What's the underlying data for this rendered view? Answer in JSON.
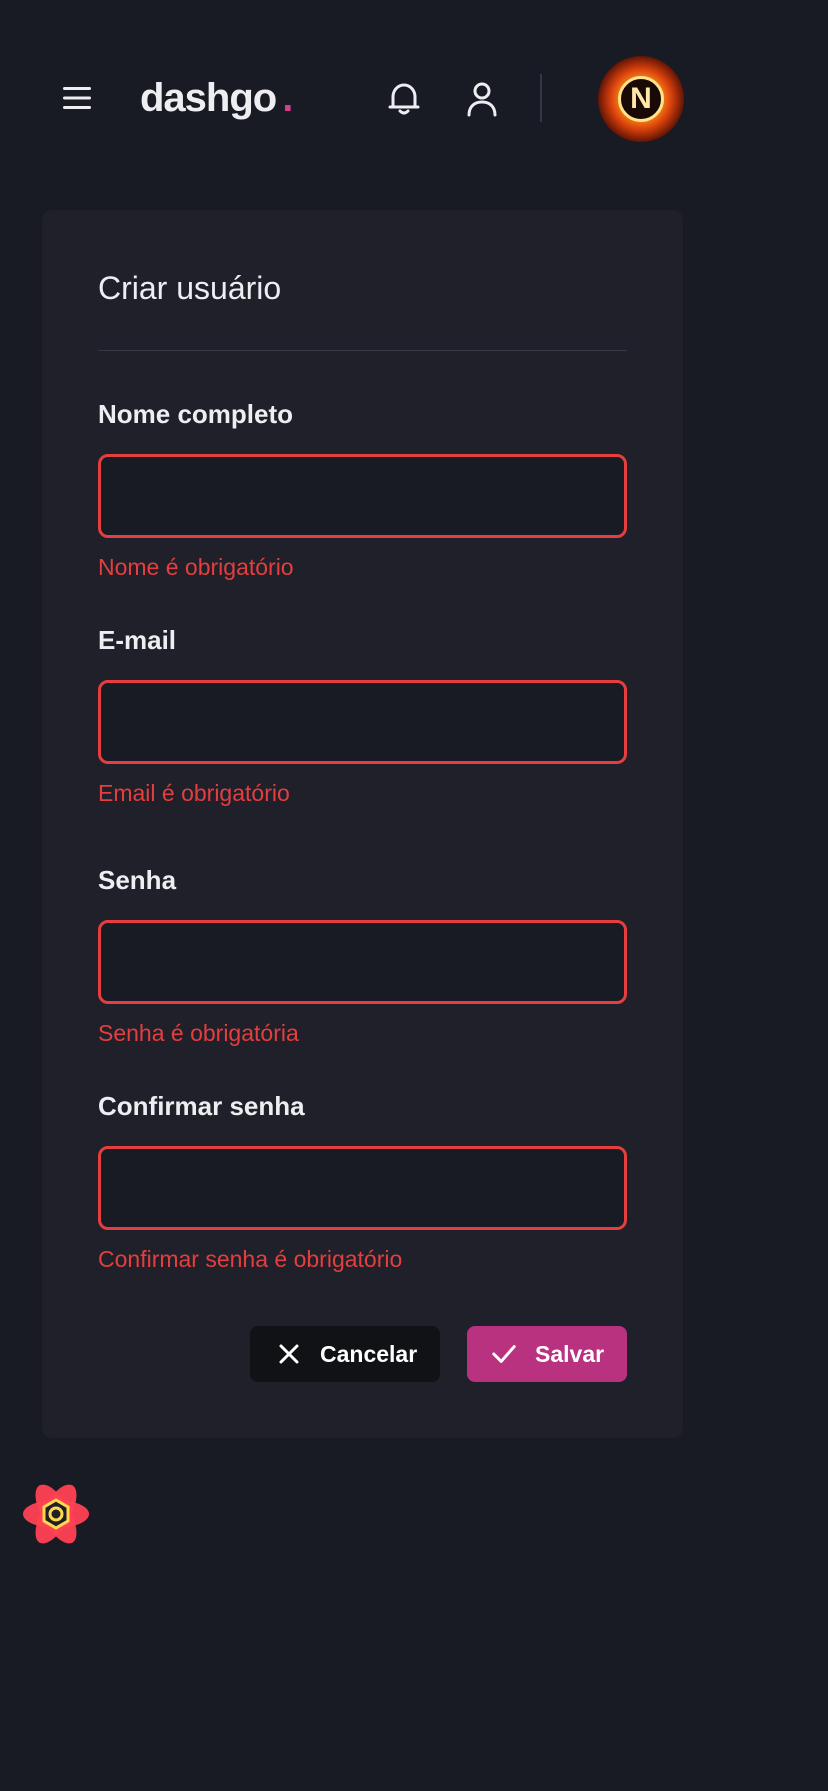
{
  "header": {
    "logo_text": "dashgo",
    "logo_dot": ".",
    "avatar_letter": "N",
    "icons": [
      "menu-icon",
      "bell-icon",
      "user-icon"
    ]
  },
  "form": {
    "title": "Criar usuário",
    "fields": [
      {
        "label": "Nome completo",
        "value": "",
        "error": "Nome é obrigatório"
      },
      {
        "label": "E-mail",
        "value": "",
        "error": "Email é obrigatório"
      },
      {
        "label": "Senha",
        "value": "",
        "error": "Senha é obrigatória"
      },
      {
        "label": "Confirmar senha",
        "value": "",
        "error": "Confirmar senha é obrigatório"
      }
    ],
    "buttons": {
      "cancel_label": "Cancelar",
      "save_label": "Salvar"
    }
  },
  "colors": {
    "background": "#181b23",
    "card": "#1f2029",
    "brand": "#d53f8c",
    "save_button": "#b83280",
    "error": "#e53e3e"
  }
}
